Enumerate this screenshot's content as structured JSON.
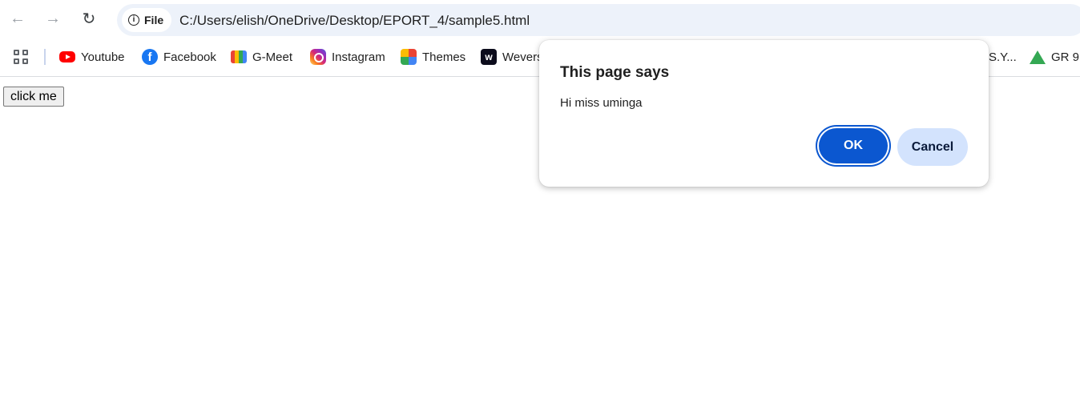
{
  "browser": {
    "site_chip": "File",
    "url": "C:/Users/elish/OneDrive/Desktop/EPORT_4/sample5.html"
  },
  "bookmarks": [
    {
      "label": "Youtube",
      "icon": "youtube-icon"
    },
    {
      "label": "Facebook",
      "icon": "facebook-icon"
    },
    {
      "label": "G-Meet",
      "icon": "google-meet-icon"
    },
    {
      "label": "Instagram",
      "icon": "instagram-icon"
    },
    {
      "label": "Themes",
      "icon": "themes-icon"
    },
    {
      "label": "Wevers",
      "icon": "weverse-icon"
    },
    {
      "label": "S.Y...",
      "icon": ""
    },
    {
      "label": "GR 9",
      "icon": "google-drive-icon"
    }
  ],
  "page": {
    "button_label": "click me"
  },
  "dialog": {
    "title": "This page says",
    "message": "Hi miss uminga",
    "ok_label": "OK",
    "cancel_label": "Cancel"
  },
  "colors": {
    "accent": "#0b57d0",
    "cancel_bg": "#d3e3fd",
    "omnibox_bg": "#edf2fa"
  }
}
